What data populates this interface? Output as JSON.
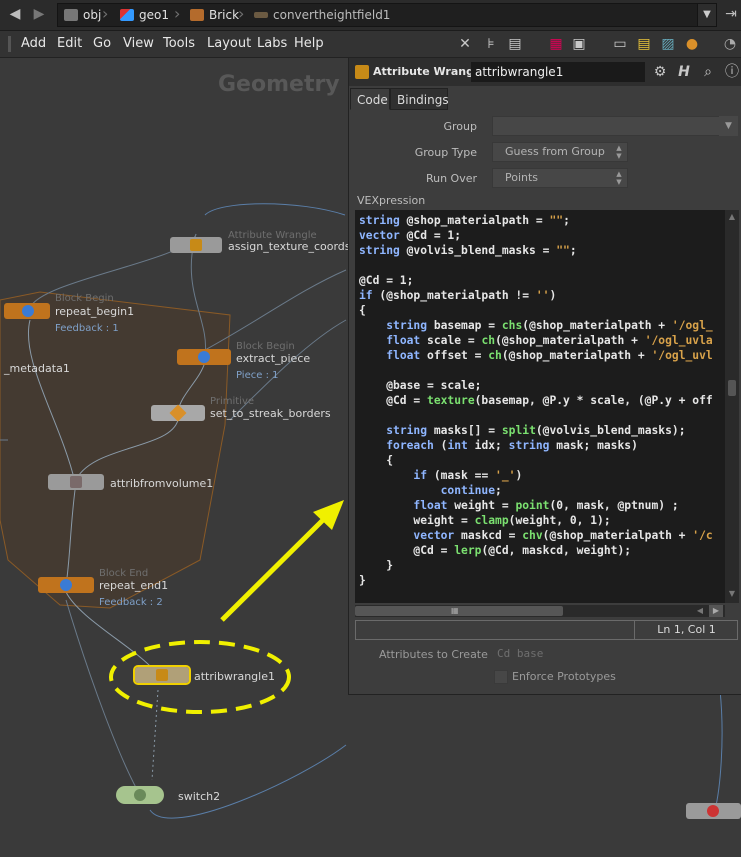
{
  "breadcrumb": {
    "items": [
      "obj",
      "geo1",
      "Brick",
      "convertheightfield1"
    ]
  },
  "menu": [
    "Add",
    "Edit",
    "Go",
    "View",
    "Tools",
    "Layout",
    "Labs",
    "Help"
  ],
  "network": {
    "label": "Geometry",
    "nodes": [
      {
        "name": "assign_texture_coords",
        "type": "Attribute Wrangle"
      },
      {
        "name": "repeat_begin1",
        "type": "Block Begin",
        "footer": "Feedback : 1"
      },
      {
        "name": "_metadata1"
      },
      {
        "name": "extract_piece",
        "type": "Block Begin",
        "footer": "Piece : 1"
      },
      {
        "name": "set_to_streak_borders",
        "type": "Primitive"
      },
      {
        "name": "attribfromvolume1"
      },
      {
        "name": "repeat_end1",
        "type": "Block End",
        "footer": "Feedback : 2"
      },
      {
        "name": "attribwrangle1"
      },
      {
        "name": "switch2"
      }
    ]
  },
  "panel": {
    "type_label": "Attribute Wrangle",
    "node_name": "attribwrangle1",
    "tabs": [
      "Code",
      "Bindings"
    ],
    "group_label": "Group",
    "group_value": "",
    "group_type_label": "Group Type",
    "group_type_value": "Guess from Group",
    "run_over_label": "Run Over",
    "run_over_value": "Points",
    "vex_label": "VEXpression",
    "cursor_pos": "Ln 1, Col 1",
    "attrs_label": "Attributes to Create",
    "attrs_value": "Cd base",
    "enforce_label": "Enforce Prototypes"
  },
  "colors": {
    "accent_arrow": "#f0f000",
    "highlight_ring": "#f0f000"
  },
  "icons": [
    "back-arrow-icon",
    "forward-arrow-icon",
    "wrench-icon",
    "gear-icon",
    "help-icon",
    "search-icon",
    "info-icon"
  ]
}
